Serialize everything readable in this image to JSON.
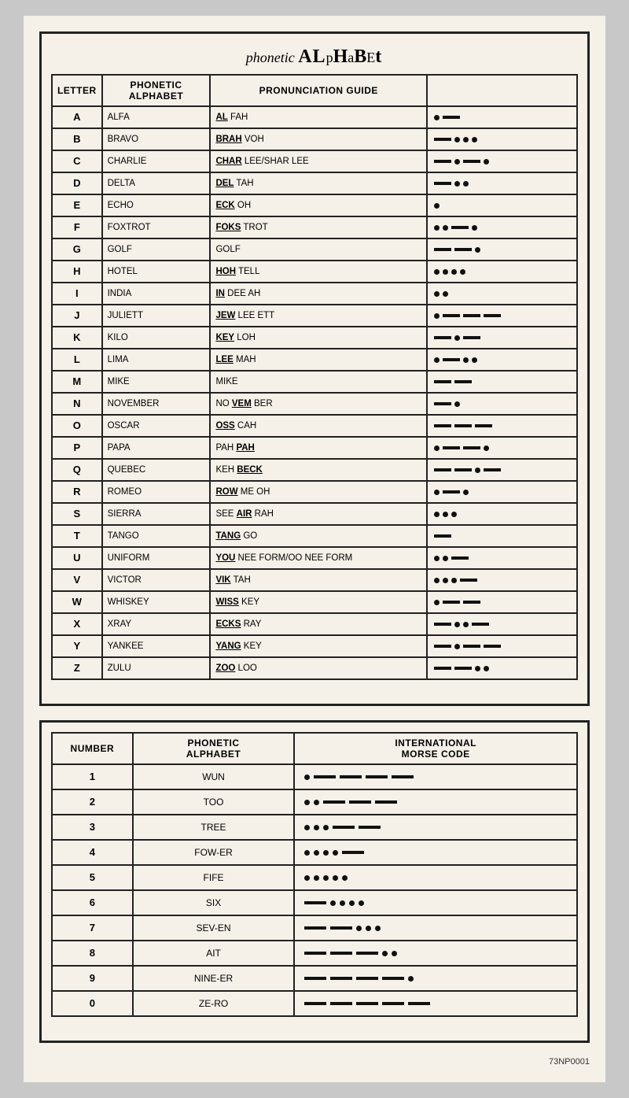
{
  "title": {
    "line1": "phonetic",
    "line2": "ALpHaBEt"
  },
  "alpha_table": {
    "headers": {
      "letter": "LETTER",
      "phonetic": "PHONETIC ALPHABET",
      "pronunciation": "PRONUNCIATION GUIDE",
      "morse": ""
    },
    "rows": [
      {
        "letter": "A",
        "phonetic": "ALFA",
        "pron_pre": "",
        "pron_und": "AL",
        "pron_post": " FAH",
        "morse": [
          "dot",
          "dash"
        ]
      },
      {
        "letter": "B",
        "phonetic": "BRAVO",
        "pron_pre": "",
        "pron_und": "BRAH",
        "pron_post": " VOH",
        "morse": [
          "dash",
          "dot",
          "dot",
          "dot"
        ]
      },
      {
        "letter": "C",
        "phonetic": "CHARLIE",
        "pron_pre": "",
        "pron_und": "CHAR",
        "pron_post": " LEE/SHAR LEE",
        "morse": [
          "dash",
          "dot",
          "dash",
          "dot"
        ]
      },
      {
        "letter": "D",
        "phonetic": "DELTA",
        "pron_pre": "",
        "pron_und": "DEL",
        "pron_post": " TAH",
        "morse": [
          "dash",
          "dot",
          "dot"
        ]
      },
      {
        "letter": "E",
        "phonetic": "ECHO",
        "pron_pre": "",
        "pron_und": "ECK",
        "pron_post": " OH",
        "morse": [
          "dot"
        ]
      },
      {
        "letter": "F",
        "phonetic": "FOXTROT",
        "pron_pre": "",
        "pron_und": "FOKS",
        "pron_post": " TROT",
        "morse": [
          "dot",
          "dot",
          "dash",
          "dot"
        ]
      },
      {
        "letter": "G",
        "phonetic": "GOLF",
        "pron_pre": "",
        "pron_und": "",
        "pron_post": "GOLF",
        "morse": [
          "dash",
          "dash",
          "dot"
        ]
      },
      {
        "letter": "H",
        "phonetic": "HOTEL",
        "pron_pre": "",
        "pron_und": "HOH",
        "pron_post": " TELL",
        "morse": [
          "dot",
          "dot",
          "dot",
          "dot"
        ]
      },
      {
        "letter": "I",
        "phonetic": "INDIA",
        "pron_pre": "",
        "pron_und": "IN",
        "pron_post": " DEE AH",
        "morse": [
          "dot",
          "dot"
        ]
      },
      {
        "letter": "J",
        "phonetic": "JULIETT",
        "pron_pre": "",
        "pron_und": "JEW",
        "pron_post": " LEE ETT",
        "morse": [
          "dot",
          "dash",
          "dash",
          "dash"
        ]
      },
      {
        "letter": "K",
        "phonetic": "KILO",
        "pron_pre": "",
        "pron_und": "KEY",
        "pron_post": " LOH",
        "morse": [
          "dash",
          "dot",
          "dash"
        ]
      },
      {
        "letter": "L",
        "phonetic": "LIMA",
        "pron_pre": "",
        "pron_und": "LEE",
        "pron_post": " MAH",
        "morse": [
          "dot",
          "dash",
          "dot",
          "dot"
        ]
      },
      {
        "letter": "M",
        "phonetic": "MIKE",
        "pron_pre": "",
        "pron_und": "",
        "pron_post": "MIKE",
        "morse": [
          "dash",
          "dash"
        ]
      },
      {
        "letter": "N",
        "phonetic": "NOVEMBER",
        "pron_pre": "NO ",
        "pron_und": "VEM",
        "pron_post": " BER",
        "morse": [
          "dash",
          "dot"
        ]
      },
      {
        "letter": "O",
        "phonetic": "OSCAR",
        "pron_pre": "",
        "pron_und": "OSS",
        "pron_post": " CAH",
        "morse": [
          "dash",
          "dash",
          "dash"
        ]
      },
      {
        "letter": "P",
        "phonetic": "PAPA",
        "pron_pre": "PAH ",
        "pron_und": "PAH",
        "pron_post": "",
        "morse": [
          "dot",
          "dash",
          "dash",
          "dot"
        ]
      },
      {
        "letter": "Q",
        "phonetic": "QUEBEC",
        "pron_pre": "KEH ",
        "pron_und": "BECK",
        "pron_post": "",
        "morse": [
          "dash",
          "dash",
          "dot",
          "dash"
        ]
      },
      {
        "letter": "R",
        "phonetic": "ROMEO",
        "pron_pre": "",
        "pron_und": "ROW",
        "pron_post": " ME OH",
        "morse": [
          "dot",
          "dash",
          "dot"
        ]
      },
      {
        "letter": "S",
        "phonetic": "SIERRA",
        "pron_pre": "SEE ",
        "pron_und": "AIR",
        "pron_post": " RAH",
        "morse": [
          "dot",
          "dot",
          "dot"
        ]
      },
      {
        "letter": "T",
        "phonetic": "TANGO",
        "pron_pre": "",
        "pron_und": "TANG",
        "pron_post": " GO",
        "morse": [
          "dash"
        ]
      },
      {
        "letter": "U",
        "phonetic": "UNIFORM",
        "pron_pre": "",
        "pron_und": "YOU",
        "pron_post": " NEE FORM/OO NEE FORM",
        "morse": [
          "dot",
          "dot",
          "dash"
        ]
      },
      {
        "letter": "V",
        "phonetic": "VICTOR",
        "pron_pre": "",
        "pron_und": "VIK",
        "pron_post": " TAH",
        "morse": [
          "dot",
          "dot",
          "dot",
          "dash"
        ]
      },
      {
        "letter": "W",
        "phonetic": "WHISKEY",
        "pron_pre": "",
        "pron_und": "WISS",
        "pron_post": " KEY",
        "morse": [
          "dot",
          "dash",
          "dash"
        ]
      },
      {
        "letter": "X",
        "phonetic": "XRAY",
        "pron_pre": "",
        "pron_und": "ECKS",
        "pron_post": " RAY",
        "morse": [
          "dash",
          "dot",
          "dot",
          "dash"
        ]
      },
      {
        "letter": "Y",
        "phonetic": "YANKEE",
        "pron_pre": "",
        "pron_und": "YANG",
        "pron_post": " KEY",
        "morse": [
          "dash",
          "dot",
          "dash",
          "dash"
        ]
      },
      {
        "letter": "Z",
        "phonetic": "ZULU",
        "pron_pre": "",
        "pron_und": "ZOO",
        "pron_post": " LOO",
        "morse": [
          "dash",
          "dash",
          "dot",
          "dot"
        ]
      }
    ]
  },
  "number_table": {
    "headers": {
      "number": "NUMBER",
      "phonetic": "PHONETIC ALPHABET",
      "morse": "INTERNATIONAL MORSE CODE"
    },
    "rows": [
      {
        "num": "1",
        "phonetic": "WUN",
        "morse": [
          "dot",
          "dash",
          "dash",
          "dash",
          "dash"
        ]
      },
      {
        "num": "2",
        "phonetic": "TOO",
        "morse": [
          "dot",
          "dot",
          "dash",
          "dash",
          "dash"
        ]
      },
      {
        "num": "3",
        "phonetic": "TREE",
        "morse": [
          "dot",
          "dot",
          "dot",
          "dash",
          "dash"
        ]
      },
      {
        "num": "4",
        "phonetic": "FOW-ER",
        "morse": [
          "dot",
          "dot",
          "dot",
          "dot",
          "dash"
        ]
      },
      {
        "num": "5",
        "phonetic": "FIFE",
        "morse": [
          "dot",
          "dot",
          "dot",
          "dot",
          "dot"
        ]
      },
      {
        "num": "6",
        "phonetic": "SIX",
        "morse": [
          "dash",
          "dot",
          "dot",
          "dot",
          "dot"
        ]
      },
      {
        "num": "7",
        "phonetic": "SEV-EN",
        "morse": [
          "dash",
          "dash",
          "dot",
          "dot",
          "dot"
        ]
      },
      {
        "num": "8",
        "phonetic": "AIT",
        "morse": [
          "dash",
          "dash",
          "dash",
          "dot",
          "dot"
        ]
      },
      {
        "num": "9",
        "phonetic": "NINE-ER",
        "morse": [
          "dash",
          "dash",
          "dash",
          "dash",
          "dot"
        ]
      },
      {
        "num": "0",
        "phonetic": "ZE-RO",
        "morse": [
          "dash",
          "dash",
          "dash",
          "dash",
          "dash"
        ]
      }
    ]
  },
  "document_number": "73NP0001"
}
